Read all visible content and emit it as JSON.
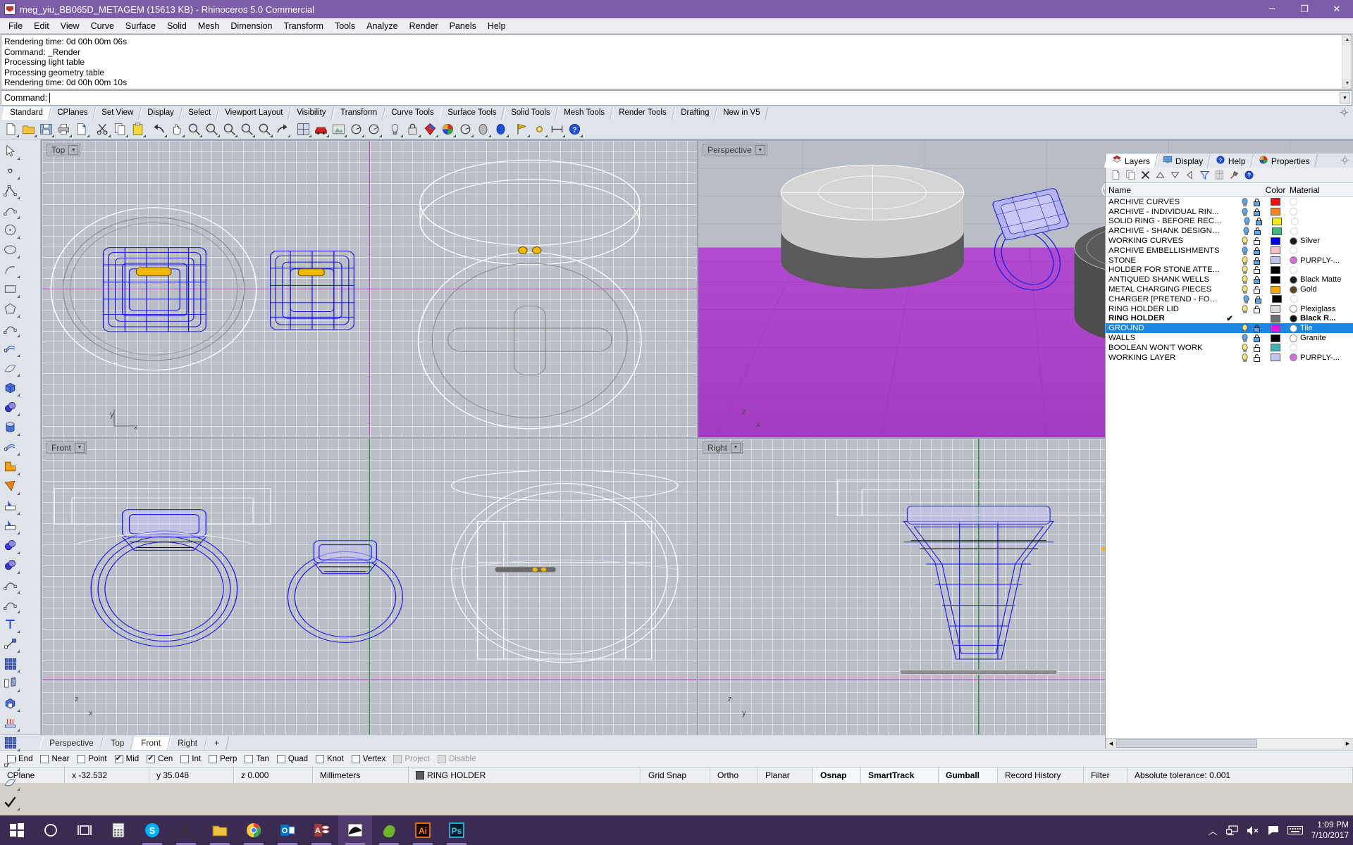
{
  "window": {
    "title": "meg_yiu_BB065D_METAGEM (15613 KB) - Rhinoceros 5.0 Commercial",
    "minimize": "─",
    "maximize": "❐",
    "close": "✕"
  },
  "menu": [
    "File",
    "Edit",
    "View",
    "Curve",
    "Surface",
    "Solid",
    "Mesh",
    "Dimension",
    "Transform",
    "Tools",
    "Analyze",
    "Render",
    "Panels",
    "Help"
  ],
  "command": {
    "history": [
      "Rendering time: 0d 00h 00m 06s",
      "Command: _Render",
      "Processing light table",
      "Processing geometry table",
      "Rendering time: 0d 00h 00m 10s"
    ],
    "prompt_label": "Command:",
    "prompt_value": ""
  },
  "toolbar_tabs": [
    {
      "label": "Standard",
      "active": true
    },
    {
      "label": "CPlanes",
      "active": false
    },
    {
      "label": "Set View",
      "active": false
    },
    {
      "label": "Display",
      "active": false
    },
    {
      "label": "Select",
      "active": false
    },
    {
      "label": "Viewport Layout",
      "active": false
    },
    {
      "label": "Visibility",
      "active": false
    },
    {
      "label": "Transform",
      "active": false
    },
    {
      "label": "Curve Tools",
      "active": false
    },
    {
      "label": "Surface Tools",
      "active": false
    },
    {
      "label": "Solid Tools",
      "active": false
    },
    {
      "label": "Mesh Tools",
      "active": false
    },
    {
      "label": "Render Tools",
      "active": false
    },
    {
      "label": "Drafting",
      "active": false
    },
    {
      "label": "New in V5",
      "active": false
    }
  ],
  "toolbar_icons": [
    "new-file-icon",
    "open-folder-icon",
    "save-icon",
    "print-icon",
    "export-icon",
    "cut-scissors-icon",
    "copy-icon",
    "paste-icon",
    "undo-arrow-icon",
    "pan-hand-icon",
    "zoom-extents-icon",
    "zoom-in-icon",
    "zoom-window-icon",
    "zoom-selected-icon",
    "zoom-target-icon",
    "redo-arrow-icon",
    "four-view-layout-icon",
    "render-car-icon",
    "render-preview-icon",
    "shade-icon",
    "cplane-icon",
    "light-bulb-icon",
    "lock-icon",
    "display-color-icon",
    "color-wheel-icon",
    "sphere-shade-icon",
    "sphere-render-icon",
    "sphere-blue-icon",
    "flag-icon",
    "options-gear-icon",
    "dimension-icon",
    "help-icon"
  ],
  "left_toolbar_icons": [
    "select-arrow-icon",
    "point-icon",
    "polyline-icon",
    "curve-icon",
    "circle-icon",
    "ellipse-icon",
    "arc-icon",
    "rectangle-icon",
    "polygon-icon",
    "curve-fillet-icon",
    "surface-from-points-icon",
    "surface-sweep-icon",
    "box-icon",
    "sphere-icon",
    "cylinder-icon",
    "surface-array-icon",
    "boolean-union-icon",
    "boolean-difference-icon",
    "trim-icon",
    "split-icon",
    "boolean-spheres-icon",
    "circle-group-icon",
    "offset-curve-icon",
    "offset-dotted-icon",
    "text-tool-icon",
    "scale-icon",
    "array-icon",
    "mirror-icon",
    "cap-icon",
    "extrude-icon",
    "rectangular-array-icon",
    "align-icon",
    "unroll-icon",
    "check-icon",
    "shell-icon",
    "flow-icon"
  ],
  "viewports": [
    {
      "name": "top-viewport",
      "label": "Top"
    },
    {
      "name": "perspective-viewport",
      "label": "Perspective"
    },
    {
      "name": "front-viewport",
      "label": "Front"
    },
    {
      "name": "right-viewport",
      "label": "Right"
    }
  ],
  "viewport_tabs": [
    {
      "label": "Perspective",
      "active": false
    },
    {
      "label": "Top",
      "active": false
    },
    {
      "label": "Front",
      "active": true
    },
    {
      "label": "Right",
      "active": false
    }
  ],
  "viewport_tab_add": "+",
  "osnaps": [
    {
      "label": "End",
      "checked": false,
      "disabled": false
    },
    {
      "label": "Near",
      "checked": false,
      "disabled": false
    },
    {
      "label": "Point",
      "checked": false,
      "disabled": false
    },
    {
      "label": "Mid",
      "checked": true,
      "disabled": false
    },
    {
      "label": "Cen",
      "checked": true,
      "disabled": false
    },
    {
      "label": "Int",
      "checked": false,
      "disabled": false
    },
    {
      "label": "Perp",
      "checked": false,
      "disabled": false
    },
    {
      "label": "Tan",
      "checked": false,
      "disabled": false
    },
    {
      "label": "Quad",
      "checked": false,
      "disabled": false
    },
    {
      "label": "Knot",
      "checked": false,
      "disabled": false
    },
    {
      "label": "Vertex",
      "checked": false,
      "disabled": false
    },
    {
      "label": "Project",
      "checked": false,
      "disabled": true
    },
    {
      "label": "Disable",
      "checked": false,
      "disabled": true
    }
  ],
  "status": {
    "cplane": "CPlane",
    "x": "x -32.532",
    "y": "y 35.048",
    "z": "z 0.000",
    "units": "Millimeters",
    "layer": "RING HOLDER",
    "grid_snap": "Grid Snap",
    "ortho": "Ortho",
    "planar": "Planar",
    "osnap": "Osnap",
    "smarttrack": "SmartTrack",
    "gumball": "Gumball",
    "record_history": "Record History",
    "filter": "Filter",
    "tolerance": "Absolute tolerance: 0.001"
  },
  "panel": {
    "tabs": [
      {
        "label": "Layers",
        "icon": "layers-icon",
        "active": true
      },
      {
        "label": "Display",
        "icon": "display-monitor-icon",
        "active": false
      },
      {
        "label": "Help",
        "icon": "help-question-icon",
        "active": false
      },
      {
        "label": "Properties",
        "icon": "properties-wheel-icon",
        "active": false
      }
    ],
    "gear": "panel-settings-gear-icon",
    "toolbar_icons": [
      "new-layer-icon",
      "copy-layer-icon",
      "delete-layer-icon",
      "move-up-icon",
      "move-down-icon",
      "back-arrow-icon",
      "filter-funnel-icon",
      "grid-properties-icon",
      "layer-tools-hammer-icon",
      "layer-help-icon"
    ],
    "columns": {
      "name": "Name",
      "color": "Color",
      "material": "Material"
    },
    "layers": [
      {
        "name": "ARCHIVE CURVES",
        "visible": "off",
        "locked": true,
        "color": "#ee1111",
        "material": "",
        "material_color": "",
        "current": false,
        "selected": false
      },
      {
        "name": "ARCHIVE - INDIVIDUAL RIN...",
        "visible": "off",
        "locked": true,
        "color": "#f58220",
        "material": "",
        "material_color": "",
        "current": false,
        "selected": false
      },
      {
        "name": "SOLID RING - BEFORE RECE...",
        "visible": "off",
        "locked": true,
        "color": "#f2e71b",
        "material": "",
        "material_color": "",
        "current": false,
        "selected": false
      },
      {
        "name": "ARCHIVE - SHANK DESIGNS...",
        "visible": "off",
        "locked": true,
        "color": "#3cb878",
        "material": "",
        "material_color": "",
        "current": false,
        "selected": false
      },
      {
        "name": "WORKING CURVES",
        "visible": "on",
        "locked": false,
        "color": "#0000ee",
        "material": "Silver",
        "material_color": "#1a1a1a",
        "current": false,
        "selected": false
      },
      {
        "name": "ARCHIVE EMBELLISHMENTS",
        "visible": "off",
        "locked": true,
        "color": "#f7bfc8",
        "material": "",
        "material_color": "",
        "current": false,
        "selected": false
      },
      {
        "name": "STONE",
        "visible": "on",
        "locked": true,
        "color": "#c3c3f2",
        "material": "PURPLY-...",
        "material_color": "#d06fd0",
        "current": false,
        "selected": false
      },
      {
        "name": "HOLDER FOR STONE ATTE...",
        "visible": "on",
        "locked": false,
        "color": "#000000",
        "material": "",
        "material_color": "",
        "current": false,
        "selected": false
      },
      {
        "name": "ANTIQUED SHANK WELLS",
        "visible": "on",
        "locked": true,
        "color": "#000000",
        "material": "Black Matte",
        "material_color": "#1a1a1a",
        "current": false,
        "selected": false
      },
      {
        "name": "METAL CHARGING PIECES",
        "visible": "on",
        "locked": false,
        "color": "#f5a800",
        "material": "Gold",
        "material_color": "#5c4423",
        "current": false,
        "selected": false
      },
      {
        "name": "CHARGER [PRETEND - FOR ...",
        "visible": "off",
        "locked": true,
        "color": "#000000",
        "material": "",
        "material_color": "",
        "current": false,
        "selected": false
      },
      {
        "name": "RING HOLDER LID",
        "visible": "on",
        "locked": false,
        "color": "#dcdcdc",
        "material": "Plexiglass",
        "material_color": "#ffffff",
        "current": false,
        "selected": false
      },
      {
        "name": "RING HOLDER",
        "visible": "current",
        "locked": false,
        "color": "#6f6f6f",
        "material": "Black R...",
        "material_color": "#111111",
        "current": true,
        "selected": false
      },
      {
        "name": "GROUND",
        "visible": "on",
        "locked": true,
        "color": "#ea13ea",
        "material": "Tile",
        "material_color": "#ffffff",
        "current": false,
        "selected": true
      },
      {
        "name": "WALLS",
        "visible": "off",
        "locked": true,
        "color": "#000000",
        "material": "Granite",
        "material_color": "#ffffff",
        "current": false,
        "selected": false
      },
      {
        "name": "BOOLEAN WON'T WORK",
        "visible": "on",
        "locked": false,
        "color": "#3cb4b4",
        "material": "",
        "material_color": "",
        "current": false,
        "selected": false
      },
      {
        "name": "WORKING LAYER",
        "visible": "on",
        "locked": false,
        "color": "#c3c3f2",
        "material": "PURPLY-...",
        "material_color": "#d06fd0",
        "current": false,
        "selected": false
      }
    ]
  },
  "taskbar": {
    "items": [
      {
        "name": "start-button-icon",
        "label": "Start"
      },
      {
        "name": "cortana-search-icon",
        "label": "Cortana"
      },
      {
        "name": "task-view-icon",
        "label": "Task View"
      },
      {
        "name": "calculator-icon",
        "label": "Calculator"
      },
      {
        "name": "skype-icon",
        "label": "Skype"
      },
      {
        "name": "snipping-tool-icon",
        "label": "Snipping Tool"
      },
      {
        "name": "file-explorer-icon",
        "label": "File Explorer"
      },
      {
        "name": "chrome-icon",
        "label": "Google Chrome"
      },
      {
        "name": "outlook-icon",
        "label": "Outlook"
      },
      {
        "name": "access-icon",
        "label": "Access"
      },
      {
        "name": "rhino-icon",
        "label": "Rhinoceros"
      },
      {
        "name": "rhino-render-icon",
        "label": "Rhino Render"
      },
      {
        "name": "illustrator-icon",
        "label": "Ai"
      },
      {
        "name": "photoshop-icon",
        "label": "Ps"
      }
    ],
    "tray": [
      "show-hidden-icons-icon",
      "network-icon",
      "volume-muted-icon",
      "action-center-icon",
      "keyboard-icon"
    ],
    "time": "1:09 PM",
    "date": "7/10/2017"
  }
}
